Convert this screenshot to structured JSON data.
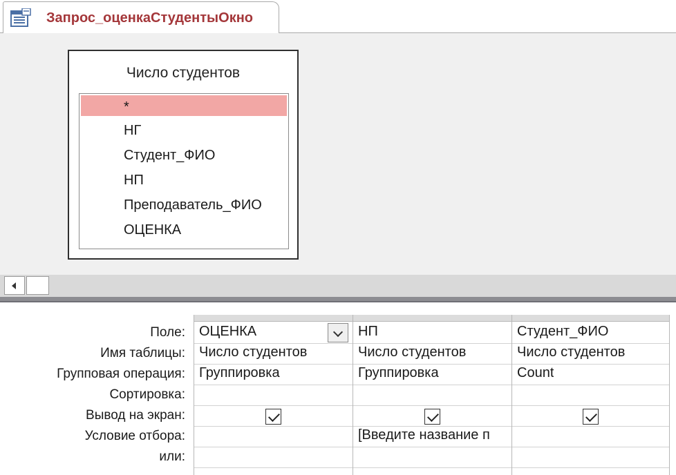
{
  "tab": {
    "icon": "query-icon",
    "title": "Запрос_оценкаСтудентыОкно"
  },
  "table": {
    "title": "Число студентов",
    "fields": [
      "*",
      "НГ",
      "Студент_ФИО",
      "НП",
      "Преподаватель_ФИО",
      "ОЦЕНКА"
    ],
    "selected_field": "*"
  },
  "grid": {
    "row_labels": {
      "field": "Поле:",
      "table": "Имя таблицы:",
      "total": "Групповая операция:",
      "sort": "Сортировка:",
      "show": "Вывод на экран:",
      "criteria": "Условие отбора:",
      "or": "или:"
    },
    "columns": [
      {
        "field": "ОЦЕНКА",
        "table": "Число студентов",
        "total": "Группировка",
        "sort": "",
        "show": true,
        "criteria": "",
        "or": ""
      },
      {
        "field": "НП",
        "table": "Число студентов",
        "total": "Группировка",
        "sort": "",
        "show": true,
        "criteria": "[Введите название п",
        "or": ""
      },
      {
        "field": "Студент_ФИО",
        "table": "Число студентов",
        "total": "Count",
        "sort": "",
        "show": true,
        "criteria": "",
        "or": ""
      }
    ]
  },
  "colors": {
    "tab_title": "#a4373a",
    "selected_field_bg": "#f2a7a5",
    "design_bg": "#f0f0f0",
    "splitter": "#8d8d92"
  }
}
